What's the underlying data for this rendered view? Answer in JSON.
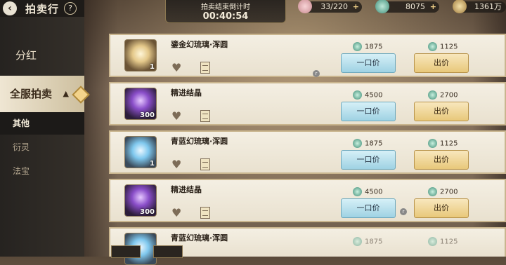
{
  "header": {
    "back_glyph": "‹",
    "title": "拍卖行",
    "help_glyph": "?",
    "countdown_label": "拍卖结束倒计时",
    "countdown_value": "00:40:54"
  },
  "resources": [
    {
      "icon": "peach-icon",
      "value": "33/220",
      "plus": "+"
    },
    {
      "icon": "spirit-stone-icon",
      "value": "8075",
      "plus": "+"
    },
    {
      "icon": "coin-icon",
      "value": "1361万"
    }
  ],
  "sidebar": {
    "fenhong": "分红",
    "quanfu": "全服拍卖",
    "quanfu_chevron": "▲",
    "subs": [
      "其他",
      "衍灵",
      "法宝"
    ]
  },
  "buttons": {
    "buyout": "一口价",
    "bid": "出价"
  },
  "items": [
    {
      "name": "鎏金幻琉璃·浑圆",
      "qty": "1",
      "icon": "gold-orb",
      "buyout": "1875",
      "bid": "1125"
    },
    {
      "name": "精进结晶",
      "qty": "300",
      "icon": "purple-crystal",
      "buyout": "4500",
      "bid": "2700"
    },
    {
      "name": "青蓝幻琉璃·浑圆",
      "qty": "1",
      "icon": "blue-orb",
      "buyout": "1875",
      "bid": "1125"
    },
    {
      "name": "精进结晶",
      "qty": "300",
      "icon": "purple-crystal",
      "buyout": "4500",
      "bid": "2700"
    },
    {
      "name": "青蓝幻琉璃·浑圆",
      "qty": "1",
      "icon": "blue-orb",
      "buyout": "1875",
      "bid": "1125"
    }
  ]
}
